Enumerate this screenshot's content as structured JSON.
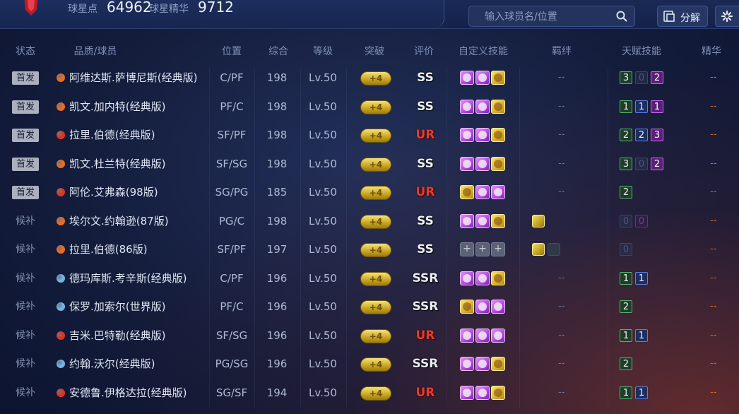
{
  "header": {
    "stat1_label": "球星点",
    "stat1_value": "64962",
    "stat2_label": "球星精华",
    "stat2_value": "9712",
    "search_placeholder": "输入球员名/位置",
    "decompose_label": "分解"
  },
  "columns": [
    "状态",
    "品质/球员",
    "位置",
    "综合",
    "等级",
    "突破",
    "评价",
    "自定义技能",
    "羁绊",
    "天赋技能",
    "精华"
  ],
  "colors": {
    "orange": "#ef6a1e",
    "red": "#e0321c",
    "blue": "#6fb6e6",
    "gold": "#e6c43a"
  },
  "rows": [
    {
      "status": "首发",
      "starter": true,
      "dot": "orange",
      "name": "阿维达斯.萨博尼斯(经典版)",
      "pos": "C/PF",
      "ovr": "198",
      "lvl": "Lv.50",
      "brk": "+4",
      "rating": "SS",
      "skills": [
        "purple",
        "purple",
        "gold"
      ],
      "bond": [],
      "bond_text": "--",
      "talents": [
        {
          "v": "3",
          "c": "green"
        },
        {
          "v": "0",
          "c": "empty"
        },
        {
          "v": "2",
          "c": "purple"
        }
      ],
      "essence": "--"
    },
    {
      "status": "首发",
      "starter": true,
      "dot": "orange",
      "name": "凯文.加内特(经典版)",
      "pos": "PF/C",
      "ovr": "198",
      "lvl": "Lv.50",
      "brk": "+4",
      "rating": "SS",
      "skills": [
        "purple",
        "purple",
        "gold"
      ],
      "bond": [],
      "bond_text": "--",
      "talents": [
        {
          "v": "1",
          "c": "green"
        },
        {
          "v": "1",
          "c": "blue"
        },
        {
          "v": "1",
          "c": "purple"
        }
      ],
      "essence": "--"
    },
    {
      "status": "首发",
      "starter": true,
      "dot": "red",
      "name": "拉里.伯德(经典版)",
      "pos": "SF/PF",
      "ovr": "198",
      "lvl": "Lv.50",
      "brk": "+4",
      "rating": "UR",
      "skills": [
        "purple",
        "purple",
        "gold"
      ],
      "bond": [],
      "bond_text": "--",
      "talents": [
        {
          "v": "2",
          "c": "green"
        },
        {
          "v": "2",
          "c": "blue"
        },
        {
          "v": "3",
          "c": "purple"
        }
      ],
      "essence": "--"
    },
    {
      "status": "首发",
      "starter": true,
      "dot": "orange",
      "name": "凯文.杜兰特(经典版)",
      "pos": "SF/SG",
      "ovr": "198",
      "lvl": "Lv.50",
      "brk": "+4",
      "rating": "SS",
      "skills": [
        "purple",
        "purple",
        "gold"
      ],
      "bond": [],
      "bond_text": "--",
      "talents": [
        {
          "v": "3",
          "c": "green"
        },
        {
          "v": "0",
          "c": "empty"
        },
        {
          "v": "2",
          "c": "purple"
        }
      ],
      "essence": "--"
    },
    {
      "status": "首发",
      "starter": true,
      "dot": "red",
      "name": "阿伦.艾弗森(98版)",
      "pos": "SG/PG",
      "ovr": "185",
      "lvl": "Lv.50",
      "brk": "+4",
      "rating": "UR",
      "skills": [
        "gold",
        "purple",
        "purple"
      ],
      "bond": [],
      "bond_text": "--",
      "talents": [
        {
          "v": "2",
          "c": "green"
        }
      ],
      "essence": "--"
    },
    {
      "status": "候补",
      "starter": false,
      "dot": "orange",
      "name": "埃尔文.约翰逊(87版)",
      "pos": "PG/C",
      "ovr": "198",
      "lvl": "Lv.50",
      "brk": "+4",
      "rating": "SS",
      "skills": [
        "purple",
        "purple",
        "gold"
      ],
      "bond": [
        "gold"
      ],
      "bond_text": "",
      "talents": [
        {
          "v": "0",
          "c": "empty"
        },
        {
          "v": "0",
          "c": "empty-p"
        }
      ],
      "essence": "--"
    },
    {
      "status": "候补",
      "starter": false,
      "dot": "orange",
      "name": "拉里.伯德(86版)",
      "pos": "SF/PF",
      "ovr": "197",
      "lvl": "Lv.50",
      "brk": "+4",
      "rating": "SS",
      "skills": [
        "grey",
        "grey",
        "grey"
      ],
      "bond": [
        "gold",
        "dim"
      ],
      "bond_text": "",
      "talents": [
        {
          "v": "0",
          "c": "empty"
        }
      ],
      "essence": "--"
    },
    {
      "status": "候补",
      "starter": false,
      "dot": "blue",
      "name": "德玛库斯.考辛斯(经典版)",
      "pos": "C/PF",
      "ovr": "196",
      "lvl": "Lv.50",
      "brk": "+4",
      "rating": "SSR",
      "skills": [
        "purple",
        "purple",
        "gold"
      ],
      "bond": [],
      "bond_text": "--",
      "talents": [
        {
          "v": "1",
          "c": "green"
        },
        {
          "v": "1",
          "c": "blue"
        }
      ],
      "essence": "--"
    },
    {
      "status": "候补",
      "starter": false,
      "dot": "blue",
      "name": "保罗.加索尔(世界版)",
      "pos": "PF/C",
      "ovr": "196",
      "lvl": "Lv.50",
      "brk": "+4",
      "rating": "SSR",
      "skills": [
        "gold",
        "purple",
        "purple"
      ],
      "bond": [],
      "bond_text": "--",
      "talents": [
        {
          "v": "2",
          "c": "green"
        }
      ],
      "essence": "--"
    },
    {
      "status": "候补",
      "starter": false,
      "dot": "red",
      "name": "吉米.巴特勒(经典版)",
      "pos": "SF/SG",
      "ovr": "196",
      "lvl": "Lv.50",
      "brk": "+4",
      "rating": "UR",
      "skills": [
        "purple",
        "purple",
        "purple"
      ],
      "bond": [],
      "bond_text": "--",
      "talents": [
        {
          "v": "1",
          "c": "green"
        },
        {
          "v": "1",
          "c": "blue"
        }
      ],
      "essence": "--"
    },
    {
      "status": "候补",
      "starter": false,
      "dot": "blue",
      "name": "约翰.沃尔(经典版)",
      "pos": "PG/SG",
      "ovr": "196",
      "lvl": "Lv.50",
      "brk": "+4",
      "rating": "SSR",
      "skills": [
        "purple",
        "purple",
        "gold"
      ],
      "bond": [],
      "bond_text": "--",
      "talents": [
        {
          "v": "2",
          "c": "green"
        }
      ],
      "essence": "--"
    },
    {
      "status": "候补",
      "starter": false,
      "dot": "red",
      "name": "安德鲁.伊格达拉(经典版)",
      "pos": "SG/SF",
      "ovr": "194",
      "lvl": "Lv.50",
      "brk": "+4",
      "rating": "UR",
      "skills": [
        "purple",
        "purple",
        "gold"
      ],
      "bond": [],
      "bond_text": "--",
      "talents": [
        {
          "v": "1",
          "c": "green"
        },
        {
          "v": "1",
          "c": "blue"
        }
      ],
      "essence": "--"
    }
  ]
}
